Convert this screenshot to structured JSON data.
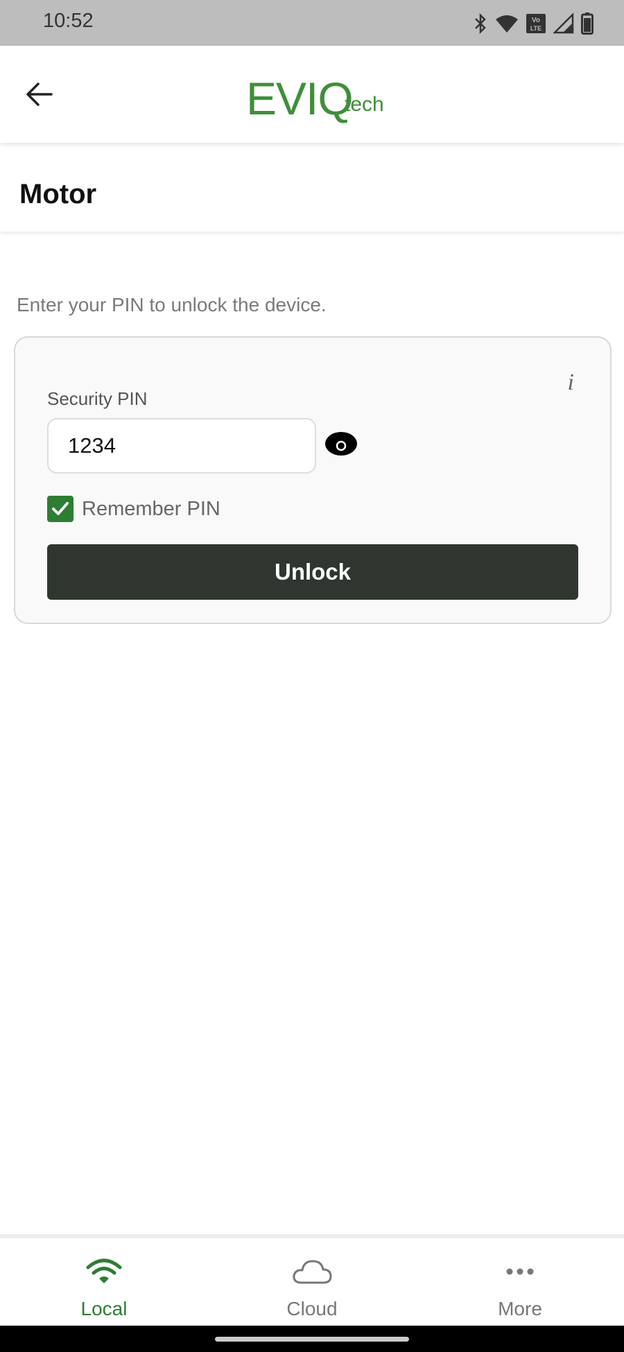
{
  "status_bar": {
    "time": "10:52",
    "icons": [
      "bluetooth-icon",
      "wifi-icon",
      "volte-icon",
      "signal-icon",
      "battery-icon"
    ]
  },
  "header": {
    "logo_main": "EVIQ",
    "logo_sub": "tech",
    "back_icon": "arrow-back-icon"
  },
  "page": {
    "title": "Motor"
  },
  "unlock_form": {
    "instructions": "Enter your PIN to unlock the device.",
    "pin_label": "Security PIN",
    "pin_value": "1234",
    "remember_label": "Remember PIN",
    "remember_checked": true,
    "unlock_label": "Unlock",
    "info_icon": "info-icon",
    "visibility_icon": "eye-icon"
  },
  "bottom_nav": {
    "items": [
      {
        "label": "Local",
        "icon": "wifi-icon",
        "active": true
      },
      {
        "label": "Cloud",
        "icon": "cloud-icon",
        "active": false
      },
      {
        "label": "More",
        "icon": "more-icon",
        "active": false
      }
    ]
  },
  "colors": {
    "brand_green": "#3f8f3a",
    "active_green": "#2e7d32",
    "button_dark": "#2e362f",
    "status_bar": "#bdbdbd"
  }
}
